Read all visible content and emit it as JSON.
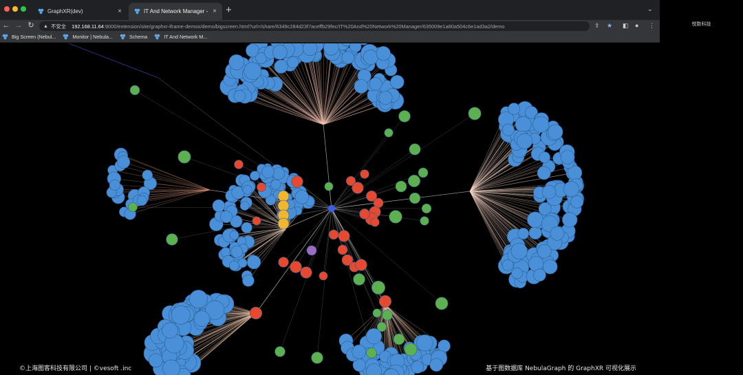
{
  "tabs": [
    {
      "title": "GraphXR(dev)",
      "active": false
    },
    {
      "title": "IT And Network Manager - Big",
      "active": true
    }
  ],
  "toolbar": {
    "security_label": "不安全",
    "url_host": "192.168.11.64",
    "url_path": ":9000/extension/site/graphxr-iframe-demos/demo/bigscreen.html?url=/share/6349c284d23f7aceffb29fec/IT%20And%20Network%20Manager/635009e1a80a504c6e1ad3a2/demo"
  },
  "bookmarks": [
    {
      "label": "Big Screen (Nebul..."
    },
    {
      "label": "Monitor | Nebula..."
    },
    {
      "label": "Schema"
    },
    {
      "label": "IT And Network M..."
    }
  ],
  "right_panel": {
    "label": "悦数科技"
  },
  "footer": {
    "left": "©上海图客科技有限公司 | ©vesoft .inc",
    "right": "基于图数据库 NebulaGraph 的 GraphXR 可视化展示"
  },
  "colors": {
    "node_blue": "#4a90d9",
    "node_red": "#e5492f",
    "node_green": "#5cb04f",
    "node_yellow": "#f1b630",
    "node_purple": "#9b6cc2",
    "edge": "#cccccc"
  },
  "icons": {
    "back": "arrow-left-icon",
    "forward": "arrow-right-icon",
    "reload": "reload-icon",
    "warning": "warning-icon",
    "star": "star-icon",
    "share": "share-icon",
    "sidebar": "sidebar-icon",
    "profile": "profile-icon",
    "menu": "kebab-menu-icon"
  }
}
